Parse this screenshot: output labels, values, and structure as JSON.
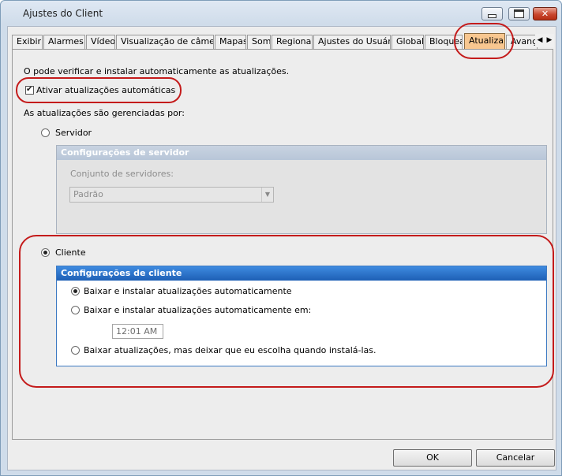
{
  "window": {
    "title": "Ajustes do  Client"
  },
  "tabs": [
    {
      "label": "Exibir",
      "active": false
    },
    {
      "label": "Alarmes",
      "active": false
    },
    {
      "label": "Vídeo",
      "active": false
    },
    {
      "label": "Visualização de câmera",
      "active": false
    },
    {
      "label": "Mapas",
      "active": false
    },
    {
      "label": "Som",
      "active": false
    },
    {
      "label": "Regional",
      "active": false
    },
    {
      "label": "Ajustes do Usuário",
      "active": false
    },
    {
      "label": "Global",
      "active": false
    },
    {
      "label": "Bloquear",
      "active": false
    },
    {
      "label": "Atualizar",
      "active": true
    },
    {
      "label": "Avançado",
      "active": false
    }
  ],
  "tab_nav": {
    "left_icon": "triangle-left",
    "right_icon": "triangle-right"
  },
  "update": {
    "intro": "O pode verificar e instalar automaticamente as atualizações.",
    "auto_update_label": "Ativar atualizações automáticas",
    "auto_update_checked": true,
    "managed_by_label": "As atualizações são gerenciadas por:",
    "server_option_label": "Servidor",
    "server_selected": false,
    "server_group_title": "Configurações de servidor",
    "server_set_label": "Conjunto de servidores:",
    "server_set_value": "Padrão",
    "client_option_label": "Cliente",
    "client_selected": true,
    "client_group_title": "Configurações de cliente",
    "client_options": [
      {
        "label": "Baixar e instalar atualizações automaticamente",
        "selected": true
      },
      {
        "label": "Baixar e instalar atualizações automaticamente em:",
        "selected": false
      },
      {
        "label": "Baixar atualizações, mas deixar que eu escolha quando instalá-las.",
        "selected": false
      }
    ],
    "time_value": "12:01 AM"
  },
  "footer": {
    "ok_label": "OK",
    "cancel_label": "Cancelar"
  },
  "colors": {
    "highlight": "#c41b1b",
    "active_tab": "#f8c790",
    "group_header": "#1d5fb5"
  }
}
